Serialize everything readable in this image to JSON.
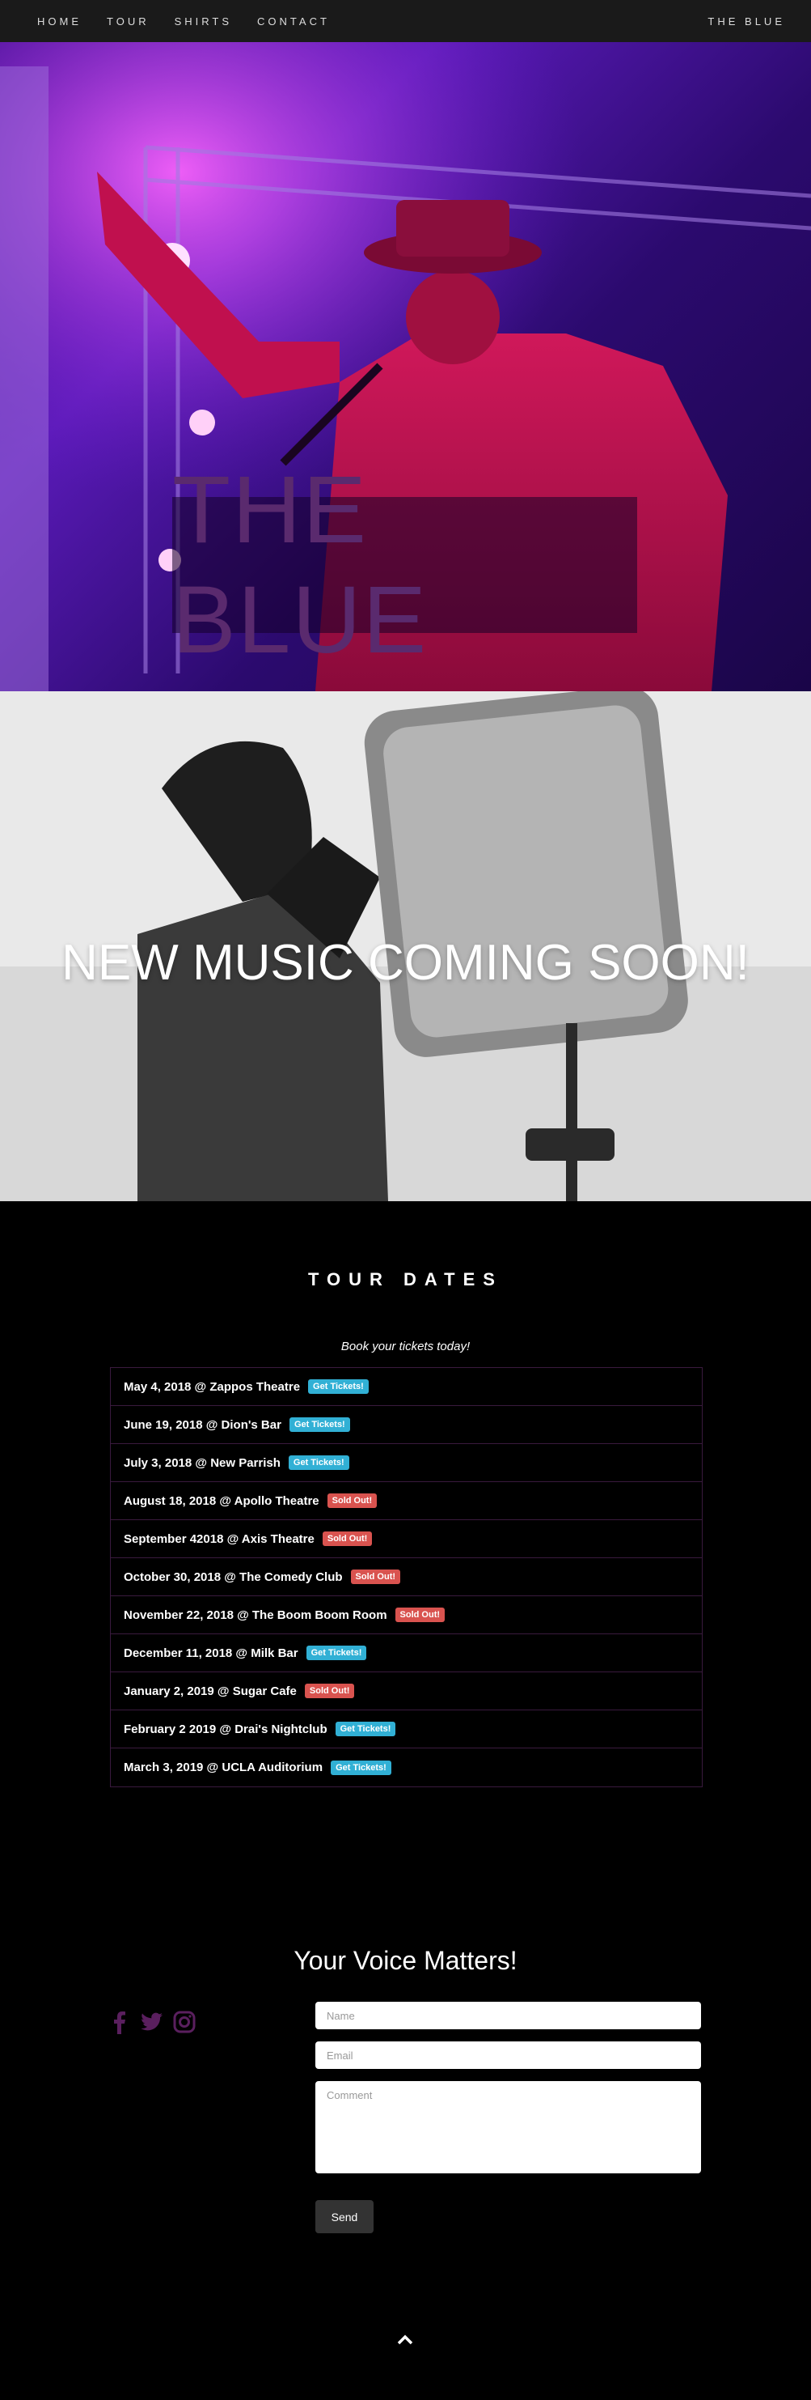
{
  "nav": {
    "links": [
      "HOME",
      "TOUR",
      "SHIRTS",
      "CONTACT"
    ],
    "brand": "THE BLUE"
  },
  "hero": {
    "title": "THE BLUE"
  },
  "music": {
    "title": "NEW MUSIC COMING SOON!"
  },
  "tour": {
    "heading": "TOUR DATES",
    "subheading": "Book your tickets today!",
    "dates": [
      {
        "text": "May 4, 2018 @ Zappos Theatre",
        "badge": "Get Tickets!",
        "status": "tickets"
      },
      {
        "text": "June 19, 2018 @ Dion's Bar",
        "badge": "Get Tickets!",
        "status": "tickets"
      },
      {
        "text": "July 3, 2018 @ New Parrish",
        "badge": "Get Tickets!",
        "status": "tickets"
      },
      {
        "text": "August 18, 2018 @ Apollo Theatre",
        "badge": "Sold Out!",
        "status": "sold"
      },
      {
        "text": "September 42018 @ Axis Theatre",
        "badge": "Sold Out!",
        "status": "sold"
      },
      {
        "text": "October 30, 2018 @ The Comedy Club",
        "badge": "Sold Out!",
        "status": "sold"
      },
      {
        "text": "November 22, 2018 @ The Boom Boom Room",
        "badge": "Sold Out!",
        "status": "sold"
      },
      {
        "text": "December 11, 2018 @ Milk Bar",
        "badge": "Get Tickets!",
        "status": "tickets"
      },
      {
        "text": "January 2, 2019 @ Sugar Cafe",
        "badge": "Sold Out!",
        "status": "sold"
      },
      {
        "text": "February 2 2019 @ Drai's Nightclub",
        "badge": "Get Tickets!",
        "status": "tickets"
      },
      {
        "text": "March 3, 2019 @ UCLA Auditorium",
        "badge": "Get Tickets!",
        "status": "tickets"
      }
    ]
  },
  "contact": {
    "heading": "Your Voice Matters!",
    "social_icons": [
      "facebook-icon",
      "twitter-icon",
      "instagram-icon"
    ],
    "name_placeholder": "Name",
    "email_placeholder": "Email",
    "comment_placeholder": "Comment",
    "send_label": "Send"
  },
  "colors": {
    "nav_bg": "#1a1a1a",
    "tickets_badge": "#31b0d5",
    "sold_badge": "#d9534f",
    "social_icon": "#5a1f5e"
  }
}
